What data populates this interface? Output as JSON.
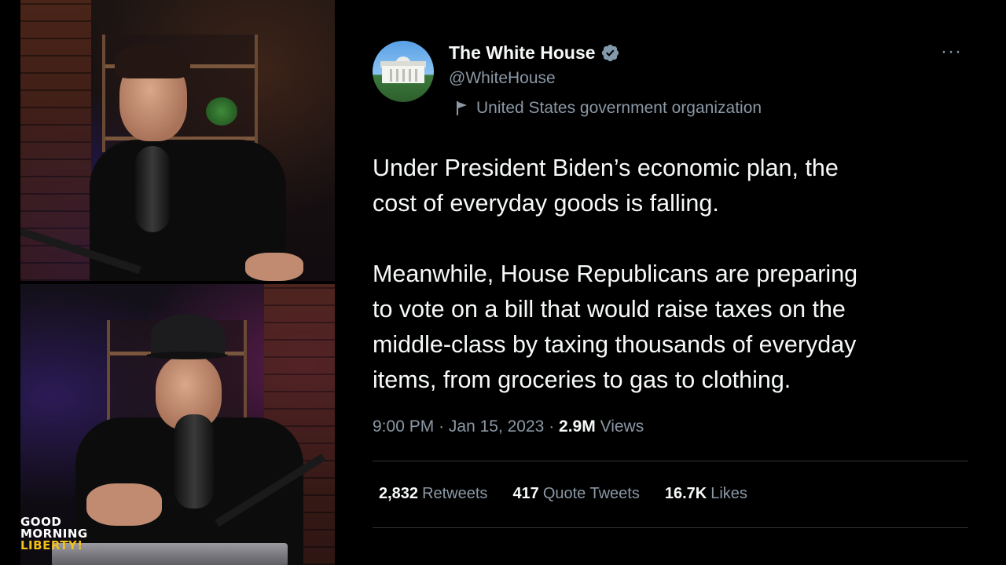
{
  "tweet": {
    "author_name": "The White House",
    "handle": "@WhiteHouse",
    "org_label": "United States government organization",
    "paragraphs": [
      "Under President Biden’s economic plan, the\ncost of everyday goods is falling.",
      "Meanwhile, House Republicans are preparing\nto vote on a bill that would raise taxes on the\nmiddle-class by taxing thousands of everyday\nitems, from groceries to gas to clothing."
    ],
    "time": "9:00 PM",
    "date": "Jan 15, 2023",
    "separator": "·",
    "views_count": "2.9M",
    "views_label": "Views",
    "retweets_count": "2,832",
    "retweets_label": "Retweets",
    "quotes_count": "417",
    "quotes_label": "Quote Tweets",
    "likes_count": "16.7K",
    "likes_label": "Likes",
    "more_icon": "more-dots-icon",
    "verified_icon": "verified-badge-icon",
    "flag_icon": "flag-icon"
  },
  "logo": {
    "line1": "GOOD",
    "line2": "MORNING",
    "line3": "LIBERTY!"
  },
  "colors": {
    "background": "#000000",
    "text_primary": "#f7f9f9",
    "text_secondary": "#8b98a5",
    "divider": "#2f3336",
    "verified": "#829aab",
    "logo_accent": "#f2c21b"
  }
}
